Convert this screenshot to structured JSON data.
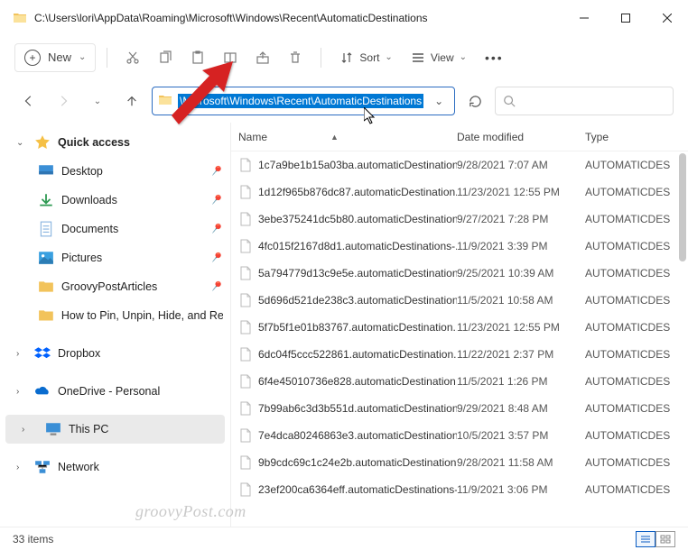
{
  "window": {
    "title": "C:\\Users\\lori\\AppData\\Roaming\\Microsoft\\Windows\\Recent\\AutomaticDestinations"
  },
  "toolbar": {
    "new_label": "New",
    "sort_label": "Sort",
    "view_label": "View"
  },
  "address": {
    "path_highlighted": "\\Microsoft\\Windows\\Recent\\AutomaticDestinations"
  },
  "columns": {
    "name": "Name",
    "date": "Date modified",
    "type": "Type"
  },
  "sidebar": {
    "quick_access": "Quick access",
    "items": [
      {
        "label": "Desktop"
      },
      {
        "label": "Downloads"
      },
      {
        "label": "Documents"
      },
      {
        "label": "Pictures"
      },
      {
        "label": "GroovyPostArticles"
      },
      {
        "label": "How to Pin, Unpin, Hide, and Re"
      }
    ],
    "dropbox": "Dropbox",
    "onedrive": "OneDrive - Personal",
    "thispc": "This PC",
    "network": "Network"
  },
  "files": [
    {
      "name": "1c7a9be1b15a03ba.automaticDestination..",
      "date": "9/28/2021 7:07 AM",
      "type": "AUTOMATICDES"
    },
    {
      "name": "1d12f965b876dc87.automaticDestination..",
      "date": "11/23/2021 12:55 PM",
      "type": "AUTOMATICDES"
    },
    {
      "name": "3ebe375241dc5b80.automaticDestination..",
      "date": "9/27/2021 7:28 PM",
      "type": "AUTOMATICDES"
    },
    {
      "name": "4fc015f2167d8d1.automaticDestinations-..",
      "date": "11/9/2021 3:39 PM",
      "type": "AUTOMATICDES"
    },
    {
      "name": "5a794779d13c9e5e.automaticDestination..",
      "date": "9/25/2021 10:39 AM",
      "type": "AUTOMATICDES"
    },
    {
      "name": "5d696d521de238c3.automaticDestination..",
      "date": "11/5/2021 10:58 AM",
      "type": "AUTOMATICDES"
    },
    {
      "name": "5f7b5f1e01b83767.automaticDestination..",
      "date": "11/23/2021 12:55 PM",
      "type": "AUTOMATICDES"
    },
    {
      "name": "6dc04f5ccc522861.automaticDestination..",
      "date": "11/22/2021 2:37 PM",
      "type": "AUTOMATICDES"
    },
    {
      "name": "6f4e45010736e828.automaticDestination..",
      "date": "11/5/2021 1:26 PM",
      "type": "AUTOMATICDES"
    },
    {
      "name": "7b99ab6c3d3b551d.automaticDestination..",
      "date": "9/29/2021 8:48 AM",
      "type": "AUTOMATICDES"
    },
    {
      "name": "7e4dca80246863e3.automaticDestination..",
      "date": "10/5/2021 3:57 PM",
      "type": "AUTOMATICDES"
    },
    {
      "name": "9b9cdc69c1c24e2b.automaticDestination..",
      "date": "9/28/2021 11:58 AM",
      "type": "AUTOMATICDES"
    },
    {
      "name": "23ef200ca6364eff.automaticDestinations-..",
      "date": "11/9/2021 3:06 PM",
      "type": "AUTOMATICDES"
    }
  ],
  "status": {
    "text": "33 items"
  },
  "watermark": "groovyPost.com"
}
